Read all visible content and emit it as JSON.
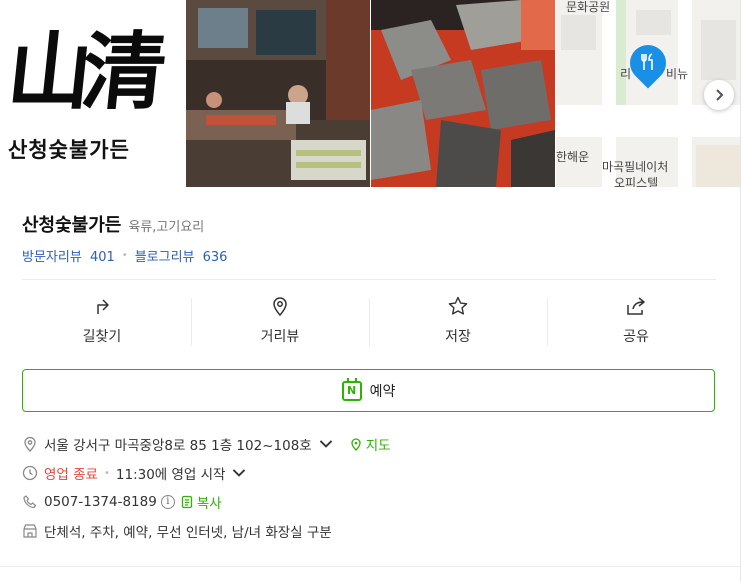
{
  "hero": {
    "logo_kanji": "山清",
    "logo_korean": "산청숯불가든",
    "map_labels": [
      "문화공원",
      "한해운",
      "마곡필네이처",
      "오피스텔",
      "리",
      "비뉴"
    ]
  },
  "place": {
    "name": "산청숯불가든",
    "category": "육류,고기요리",
    "visitor_review_label": "방문자리뷰",
    "visitor_review_count": "401",
    "blog_review_label": "블로그리뷰",
    "blog_review_count": "636"
  },
  "actions": [
    {
      "label": "길찾기",
      "icon": "directions-icon"
    },
    {
      "label": "거리뷰",
      "icon": "street-view-pin-icon"
    },
    {
      "label": "저장",
      "icon": "star-icon"
    },
    {
      "label": "공유",
      "icon": "share-icon"
    }
  ],
  "reserve": {
    "label": "예약",
    "icon_letter": "N"
  },
  "details": {
    "address": "서울 강서구 마곡중앙8로 85 1층 102~108호",
    "map_link": "지도",
    "status": "영업 종료",
    "hours": "11:30에 영업 시작",
    "phone": "0507-1374-8189",
    "info_glyph": "i",
    "copy_link": "복사",
    "amenities": "단체석, 주차, 예약, 무선 인터넷, 남/녀 화장실 구분"
  },
  "colors": {
    "accent_green": "#2db400",
    "link_blue": "#2b5fb5",
    "closed_red": "#e8453c",
    "pin_blue": "#1a8fe6"
  }
}
